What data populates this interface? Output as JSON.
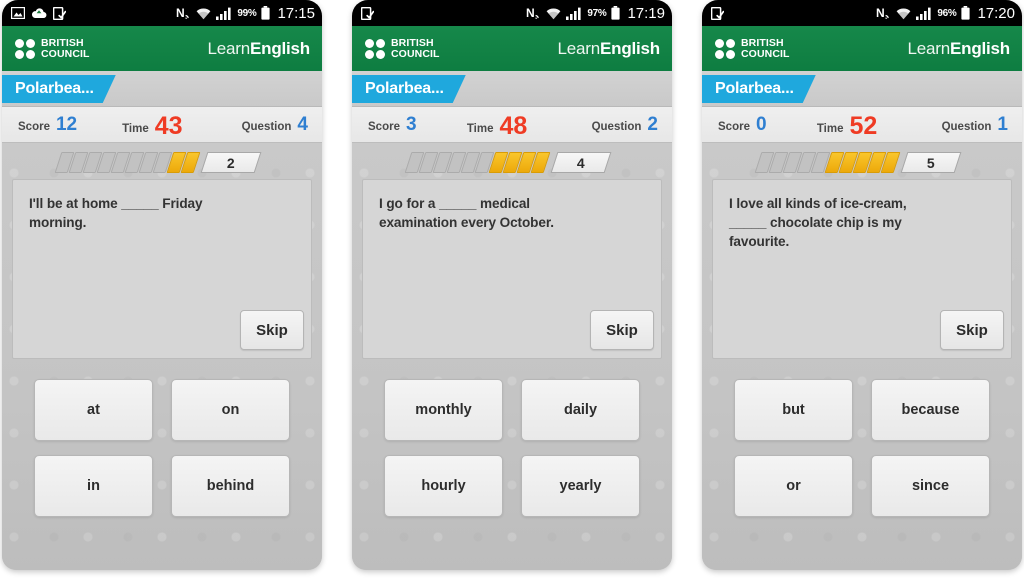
{
  "app": {
    "brand_line1": "BRITISH",
    "brand_line2": "COUNCIL",
    "logo_learn": "Learn",
    "logo_english": "English",
    "brand_green": "#13853f",
    "tab_blue": "#1fa8dd",
    "score_blue": "#2f7fd1",
    "time_red": "#ef3b24",
    "bar_yellow": "#f5b816"
  },
  "labels": {
    "score": "Score",
    "time": "Time",
    "question": "Question",
    "skip": "Skip"
  },
  "phones": [
    {
      "status": {
        "time": "17:15",
        "battery": "99%",
        "left_icons": [
          "image-icon",
          "cloud-upload-icon",
          "device-sync-icon"
        ],
        "right_icons": [
          "nfc-icon",
          "wifi-icon",
          "signal-icon",
          "battery-icon"
        ]
      },
      "tab": "Polarbea...",
      "stats": {
        "score": "12",
        "time": "43",
        "question": "4"
      },
      "progress": {
        "total": 10,
        "filled": 2,
        "badge": "2"
      },
      "question": "I'll be at home _____ Friday\nmorning.",
      "answers": [
        "at",
        "on",
        "in",
        "behind"
      ]
    },
    {
      "status": {
        "time": "17:19",
        "battery": "97%",
        "left_icons": [
          "device-sync-icon"
        ],
        "right_icons": [
          "nfc-icon",
          "wifi-icon",
          "signal-icon",
          "battery-icon"
        ]
      },
      "tab": "Polarbea...",
      "stats": {
        "score": "3",
        "time": "48",
        "question": "2"
      },
      "progress": {
        "total": 10,
        "filled": 4,
        "badge": "4"
      },
      "question": "I go for a _____ medical\nexamination every October.",
      "answers": [
        "monthly",
        "daily",
        "hourly",
        "yearly"
      ]
    },
    {
      "status": {
        "time": "17:20",
        "battery": "96%",
        "left_icons": [
          "device-sync-icon"
        ],
        "right_icons": [
          "nfc-icon",
          "wifi-icon",
          "signal-icon",
          "battery-icon"
        ]
      },
      "tab": "Polarbea...",
      "stats": {
        "score": "0",
        "time": "52",
        "question": "1"
      },
      "progress": {
        "total": 10,
        "filled": 5,
        "badge": "5"
      },
      "question": "I love all kinds of ice-cream,\n_____ chocolate chip is my\nfavourite.",
      "answers": [
        "but",
        "because",
        "or",
        "since"
      ]
    }
  ]
}
